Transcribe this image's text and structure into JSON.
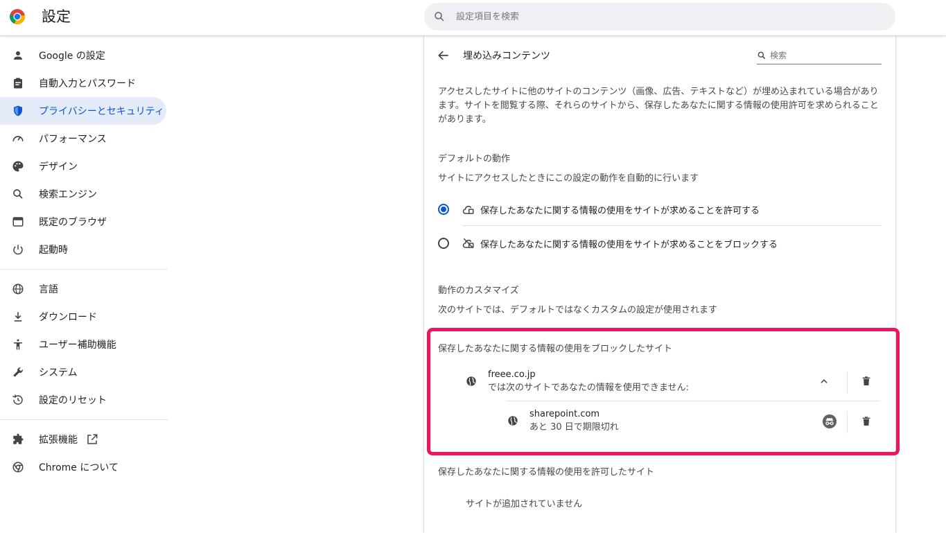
{
  "header": {
    "title": "設定",
    "search_placeholder": "設定項目を検索"
  },
  "sidebar": {
    "items": [
      {
        "label": "Google の設定",
        "icon": "person-icon"
      },
      {
        "label": "自動入力とパスワード",
        "icon": "clipboard-icon"
      },
      {
        "label": "プライバシーとセキュリティ",
        "icon": "shield-icon",
        "active": true
      },
      {
        "label": "パフォーマンス",
        "icon": "speedometer-icon"
      },
      {
        "label": "デザイン",
        "icon": "palette-icon"
      },
      {
        "label": "検索エンジン",
        "icon": "search-icon"
      },
      {
        "label": "既定のブラウザ",
        "icon": "browser-window-icon"
      },
      {
        "label": "起動時",
        "icon": "power-icon"
      },
      {
        "label": "言語",
        "icon": "globe-icon"
      },
      {
        "label": "ダウンロード",
        "icon": "download-icon"
      },
      {
        "label": "ユーザー補助機能",
        "icon": "accessibility-icon"
      },
      {
        "label": "システム",
        "icon": "wrench-icon"
      },
      {
        "label": "設定のリセット",
        "icon": "history-icon"
      },
      {
        "label": "拡張機能",
        "icon": "puzzle-icon"
      },
      {
        "label": "Chrome について",
        "icon": "chrome-icon"
      }
    ]
  },
  "page": {
    "title": "埋め込みコンテンツ",
    "search_placeholder": "検索",
    "description": "アクセスしたサイトに他のサイトのコンテンツ（画像、広告、テキストなど）が埋め込まれている場合があります。サイトを閲覧する際、それらのサイトから、保存したあなたに関する情報の使用許可を求められることがあります。",
    "default_behavior_heading": "デフォルトの動作",
    "default_behavior_sub": "サイトにアクセスしたときにこの設定の動作を自動的に行います",
    "options": [
      {
        "label": "保存したあなたに関する情報の使用をサイトが求めることを許可する",
        "selected": true
      },
      {
        "label": "保存したあなたに関する情報の使用をサイトが求めることをブロックする",
        "selected": false
      }
    ],
    "customize_heading": "動作のカスタマイズ",
    "customize_sub": "次のサイトでは、デフォルトではなくカスタムの設定が使用されます",
    "blocked_heading": "保存したあなたに関する情報の使用をブロックしたサイト",
    "blocked_site": {
      "name": "freee.co.jp",
      "sub": "では次のサイトであなたの情報を使用できません:",
      "embedded": {
        "name": "sharepoint.com",
        "sub": "あと 30 日で期限切れ"
      }
    },
    "allowed_heading": "保存したあなたに関する情報の使用を許可したサイト",
    "allowed_empty": "サイトが追加されていません"
  },
  "colors": {
    "accent": "#0b57d0",
    "highlight": "#ee1560"
  }
}
